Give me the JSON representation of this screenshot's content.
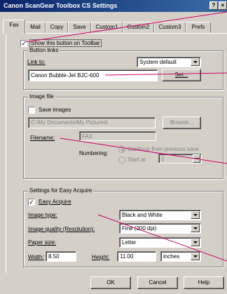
{
  "window": {
    "title": "Canon ScanGear Toolbox CS Settings"
  },
  "titlebar_buttons": {
    "help": "?",
    "close": "×"
  },
  "tabs": [
    "Fax",
    "Mail",
    "Copy",
    "Save",
    "Custom1",
    "Custom2",
    "Custom3",
    "Prefs"
  ],
  "active_tab": "Fax",
  "show_on_toolbar": {
    "label": "Show this button on Toolbar",
    "checked": true
  },
  "button_links": {
    "group_label": "Button links",
    "link_to_label": "Link to:",
    "link_to_value": "System default",
    "device_value": "Canon Bubble-Jet BJC-600",
    "set_button": "Set..."
  },
  "image_file": {
    "group_label": "Image file",
    "save_images_label": "Save images",
    "path_value": "C:\\My Documents\\My Pictures\\",
    "browse_button": "Browse...",
    "filename_label": "Filename:",
    "filename_value": "FAX",
    "numbering_label": "Numbering:",
    "continue_label": "Continue from previous save",
    "start_at_label": "Start at",
    "start_at_value": "0"
  },
  "easy_acquire": {
    "group_label": "Settings for Easy Acquire",
    "easy_acquire_label": "Easy Acquire",
    "easy_acquire_checked": true,
    "image_type_label": "Image type:",
    "image_type_value": "Black and White",
    "image_quality_label": "Image quality (Resolution):",
    "image_quality_value": "Fine (200 dpi)",
    "paper_size_label": "Paper size:",
    "paper_size_value": "Letter",
    "width_label": "Width:",
    "width_value": "8.50",
    "height_label": "Height:",
    "height_value": "11.00",
    "units_value": "inches"
  },
  "footer": {
    "ok": "OK",
    "cancel": "Cancel",
    "help": "Help"
  },
  "colors": {
    "titlebar": "#0a246a",
    "face": "#d4d0c8",
    "callout": "#cc0066"
  }
}
